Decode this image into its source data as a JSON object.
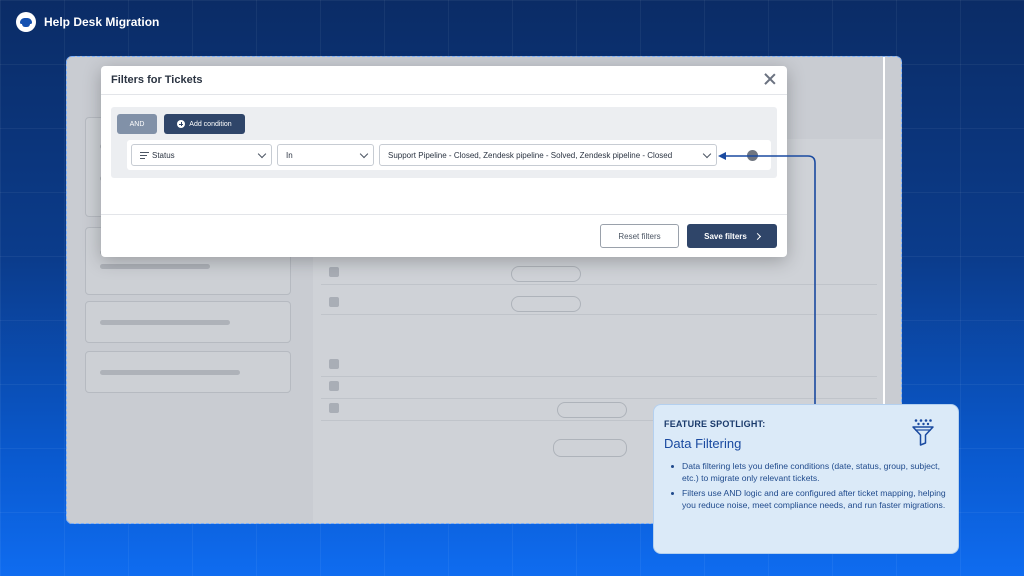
{
  "brand": {
    "name": "Help Desk Migration"
  },
  "modal": {
    "title": "Filters for Tickets",
    "and_label": "AND",
    "add_condition_label": "Add condition",
    "condition": {
      "field": "Status",
      "operator": "In",
      "value": "Support Pipeline - Closed, Zendesk pipeline - Solved, Zendesk pipeline - Closed"
    },
    "reset_label": "Reset filters",
    "save_label": "Save filters"
  },
  "spotlight": {
    "kicker": "FEATURE SPOTLIGHT:",
    "title": "Data Filtering",
    "bullets": [
      "Data filtering lets you define conditions (date, status, group, subject, etc.) to migrate only relevant tickets.",
      "Filters use AND logic and are configured after ticket mapping, helping you reduce noise, meet compliance needs, and run faster migrations."
    ]
  },
  "colors": {
    "accent": "#2f4569",
    "connector": "#1a4aa0",
    "spotlight_bg": "#dbeaf8"
  },
  "icons": [
    "close-icon",
    "plus-icon",
    "filter-lines-icon",
    "chevron-down-icon",
    "arrow-right-icon",
    "funnel-icon"
  ]
}
